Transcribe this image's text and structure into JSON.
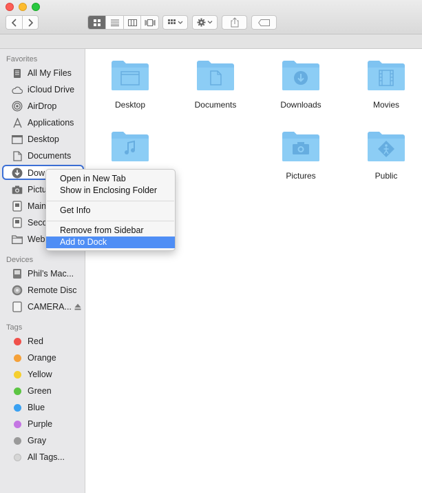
{
  "toolbar": {
    "back": "back-chevron",
    "forward": "forward-chevron",
    "views": [
      "icon-view",
      "list-view",
      "column-view",
      "cover-flow-view"
    ],
    "arrange": "arrange",
    "action": "action",
    "share": "share",
    "tags": "tags"
  },
  "sidebar": {
    "favorites_header": "Favorites",
    "favorites": [
      {
        "label": "All My Files",
        "icon": "all-files-icon"
      },
      {
        "label": "iCloud Drive",
        "icon": "cloud-icon"
      },
      {
        "label": "AirDrop",
        "icon": "airdrop-icon"
      },
      {
        "label": "Applications",
        "icon": "applications-icon"
      },
      {
        "label": "Desktop",
        "icon": "desktop-icon"
      },
      {
        "label": "Documents",
        "icon": "documents-icon"
      },
      {
        "label": "Dow",
        "icon": "downloads-icon"
      },
      {
        "label": "Pictu",
        "icon": "camera-icon"
      },
      {
        "label": "Main",
        "icon": "drive-icon"
      },
      {
        "label": "Seco",
        "icon": "drive-icon"
      },
      {
        "label": "Web",
        "icon": "folder-icon"
      }
    ],
    "devices_header": "Devices",
    "devices": [
      {
        "label": "Phil’s Mac...",
        "icon": "hard-drive-icon"
      },
      {
        "label": "Remote Disc",
        "icon": "disc-icon"
      },
      {
        "label": "CAMERA...",
        "icon": "external-drive-icon"
      }
    ],
    "tags_header": "Tags",
    "tags": [
      {
        "label": "Red",
        "color": "#f0514b"
      },
      {
        "label": "Orange",
        "color": "#f5a13a"
      },
      {
        "label": "Yellow",
        "color": "#f5cf2f"
      },
      {
        "label": "Green",
        "color": "#5cc543"
      },
      {
        "label": "Blue",
        "color": "#3aa1f2"
      },
      {
        "label": "Purple",
        "color": "#c476e3"
      },
      {
        "label": "Gray",
        "color": "#9a9a9a"
      },
      {
        "label": "All Tags...",
        "color": "#d6d6d6"
      }
    ]
  },
  "files": [
    {
      "name": "Desktop",
      "glyph": "window"
    },
    {
      "name": "Documents",
      "glyph": "page"
    },
    {
      "name": "Downloads",
      "glyph": "download"
    },
    {
      "name": "Movies",
      "glyph": "film"
    },
    {
      "name": "",
      "glyph": "music"
    },
    {
      "name": "Pictures",
      "glyph": "camera"
    },
    {
      "name": "Public",
      "glyph": "public"
    }
  ],
  "context_menu": {
    "items": [
      "Open in New Tab",
      "Show in Enclosing Folder",
      "Get Info",
      "Remove from Sidebar",
      "Add to Dock"
    ],
    "highlighted": "Add to Dock"
  },
  "colors": {
    "accent": "#4f8ef5",
    "focus_ring": "#3b6fd6",
    "folder": "#7fc3f1"
  }
}
